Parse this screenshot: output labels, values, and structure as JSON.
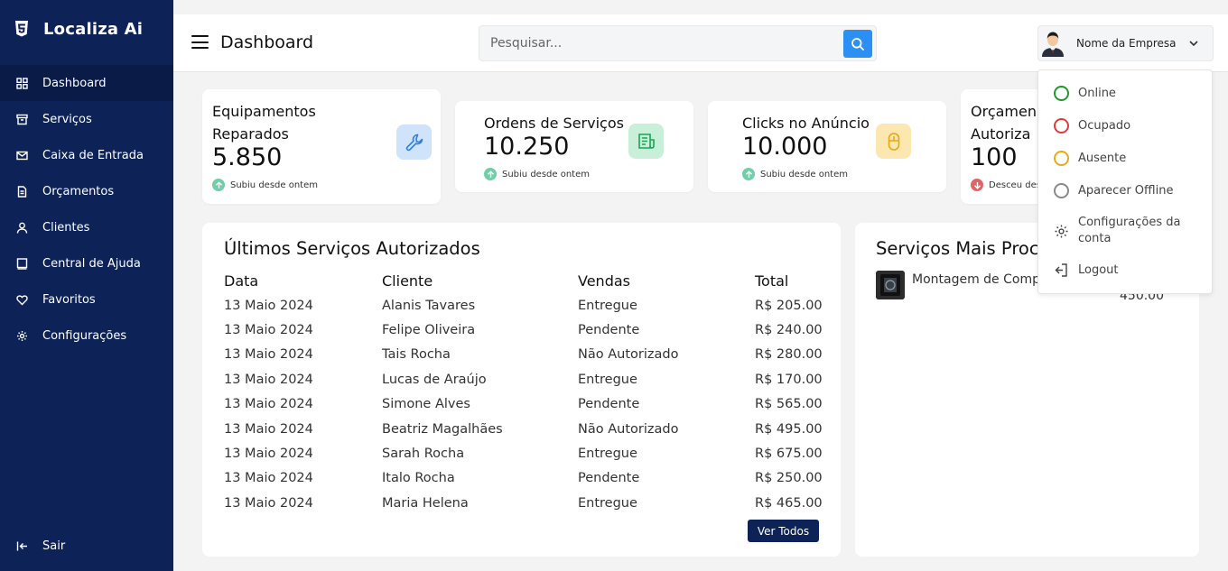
{
  "app": {
    "name": "Localiza Ai"
  },
  "sidebar": {
    "items": [
      {
        "label": "Dashboard",
        "icon": "grid-icon"
      },
      {
        "label": "Serviços",
        "icon": "archive-icon"
      },
      {
        "label": "Caixa de Entrada",
        "icon": "mail-icon"
      },
      {
        "label": "Orçamentos",
        "icon": "document-icon"
      },
      {
        "label": "Clientes",
        "icon": "user-icon"
      },
      {
        "label": "Central de Ajuda",
        "icon": "help-book-icon"
      },
      {
        "label": "Favoritos",
        "icon": "heart-icon"
      },
      {
        "label": "Configurações",
        "icon": "gear-icon"
      }
    ],
    "logout_label": "Sair"
  },
  "header": {
    "title": "Dashboard",
    "search_placeholder": "Pesquisar...",
    "profile_name": "Nome da Empresa"
  },
  "stats": [
    {
      "title_line1": "Equipamentos",
      "title_line2": "Reparados",
      "value": "5.850",
      "trend": "Subiu desde ontem",
      "trend_dir": "up",
      "icon": "wrench-icon",
      "icon_bg": "#cfe3fb",
      "icon_color": "#2b7fe0"
    },
    {
      "title_line1": "Ordens de Serviços",
      "value": "10.250",
      "trend": "Subiu desde ontem",
      "trend_dir": "up",
      "icon": "receipt-icon",
      "icon_bg": "#c8f0d8",
      "icon_color": "#19a553"
    },
    {
      "title_line1": "Clicks no Anúncio",
      "value": "10.000",
      "trend": "Subiu desde ontem",
      "trend_dir": "up",
      "icon": "mouse-icon",
      "icon_bg": "#fde7b0",
      "icon_color": "#e6a813"
    },
    {
      "title_line1": "Orçamen",
      "title_line2": "Autoriza",
      "value": "100",
      "trend": "Desceu des",
      "trend_dir": "down"
    }
  ],
  "colors": {
    "trend_up": "#6fcfa8",
    "trend_down": "#e26565",
    "sidebar_bg": "#0d2257",
    "accent": "#2b8ff5"
  },
  "recent_services": {
    "title": "Últimos Serviços Autorizados",
    "columns": [
      "Data",
      "Cliente",
      "Vendas",
      "Total"
    ],
    "rows": [
      [
        "13 Maio 2024",
        "Alanis Tavares",
        "Entregue",
        "R$ 205.00"
      ],
      [
        "13 Maio 2024",
        "Felipe Oliveira",
        "Pendente",
        "R$ 240.00"
      ],
      [
        "13 Maio 2024",
        "Tais Rocha",
        "Não Autorizado",
        "R$ 280.00"
      ],
      [
        "13 Maio 2024",
        "Lucas de Araújo",
        "Entregue",
        "R$ 170.00"
      ],
      [
        "13 Maio 2024",
        "Simone Alves",
        "Pendente",
        "R$ 565.00"
      ],
      [
        "13 Maio 2024",
        "Beatriz Magalhães",
        "Não Autorizado",
        "R$ 495.00"
      ],
      [
        "13 Maio 2024",
        "Sarah Rocha",
        "Entregue",
        "R$ 675.00"
      ],
      [
        "13 Maio 2024",
        "Italo Rocha",
        "Pendente",
        "R$ 250.00"
      ],
      [
        "13 Maio 2024",
        "Maria Helena",
        "Entregue",
        "R$ 465.00"
      ]
    ],
    "view_all_label": "Ver Todos"
  },
  "top_services": {
    "title": "Serviços Mais Proc",
    "items": [
      {
        "name": "Montagem de Comp Gamer",
        "price": "450.00"
      }
    ]
  },
  "status_menu": {
    "items": [
      {
        "label": "Online",
        "color": "#1e9a2f"
      },
      {
        "label": "Ocupado",
        "color": "#e03a3a"
      },
      {
        "label": "Ausente",
        "color": "#f0a818"
      },
      {
        "label": "Aparecer Offline",
        "color": "#8a8a8a"
      }
    ],
    "settings_label": "Configurações da conta",
    "logout_label": "Logout"
  }
}
